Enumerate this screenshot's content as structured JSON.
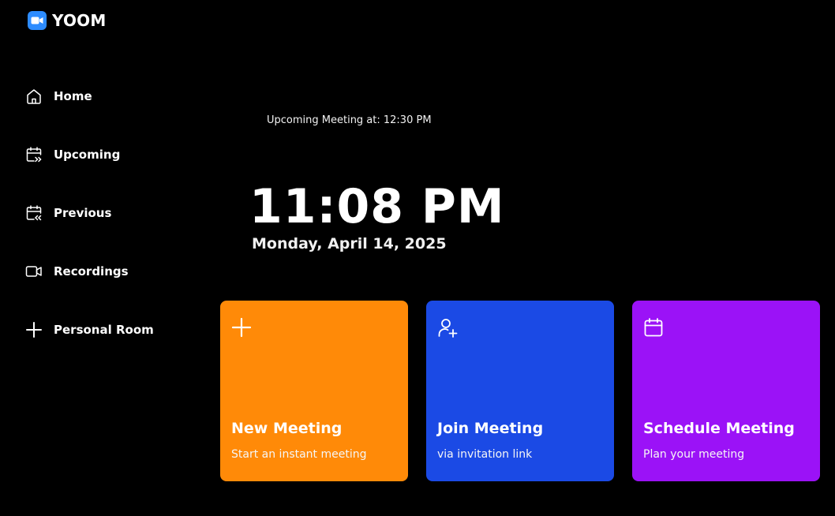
{
  "app": {
    "name": "YOOM",
    "brand_color": "#2d8cff",
    "logo_icon": "video-camera-icon"
  },
  "sidebar": {
    "items": [
      {
        "label": "Home",
        "icon": "home-icon"
      },
      {
        "label": "Upcoming",
        "icon": "calendar-forward-icon"
      },
      {
        "label": "Previous",
        "icon": "calendar-back-icon"
      },
      {
        "label": "Recordings",
        "icon": "video-icon"
      },
      {
        "label": "Personal Room",
        "icon": "plus-icon"
      }
    ]
  },
  "main": {
    "upcoming_note": "Upcoming Meeting at: 12:30 PM",
    "time": "11:08 PM",
    "date": "Monday, April 14, 2025",
    "cards": [
      {
        "title": "New Meeting",
        "subtitle": "Start an instant meeting",
        "icon": "plus-icon",
        "color": "#ff8a08"
      },
      {
        "title": "Join Meeting",
        "subtitle": "via invitation link",
        "icon": "add-user-icon",
        "color": "#1b4ae5"
      },
      {
        "title": "Schedule Meeting",
        "subtitle": "Plan your meeting",
        "icon": "calendar-icon",
        "color": "#9b12f7"
      }
    ]
  }
}
